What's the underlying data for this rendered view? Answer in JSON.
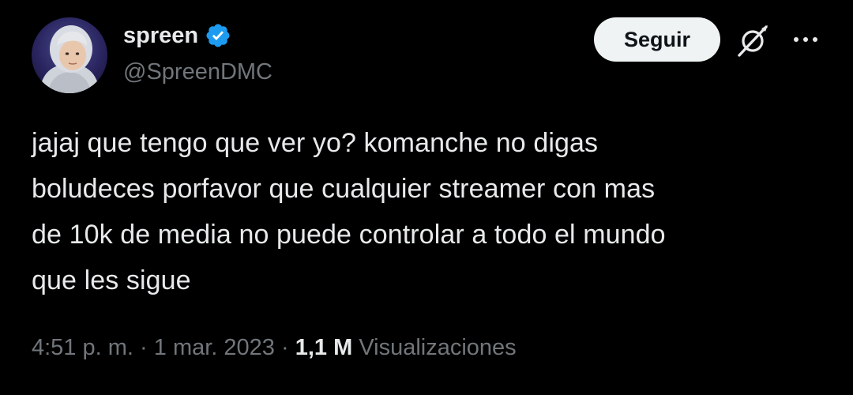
{
  "author": {
    "display_name": "spreen",
    "handle": "@SpreenDMC",
    "verified": true,
    "verified_color": "#1d9bf0",
    "avatar_icon": "user-avatar"
  },
  "actions": {
    "follow_label": "Seguir",
    "grok_icon": "grok-icon",
    "more_icon": "more-dots-icon"
  },
  "tweet": {
    "lines": [
      "jajaj que tengo que ver yo? komanche no digas",
      "boludeces porfavor que cualquier streamer con mas",
      "de 10k de media no puede controlar a todo el mundo",
      "que les sigue"
    ]
  },
  "meta": {
    "time": "4:51 p. m.",
    "separator": "·",
    "date": "1 mar. 2023",
    "views_count": "1,1 M",
    "views_label": "Visualizaciones"
  },
  "colors": {
    "background": "#000000",
    "text_primary": "#e7e9ea",
    "text_secondary": "#71767b",
    "button_bg": "#eff3f4"
  }
}
